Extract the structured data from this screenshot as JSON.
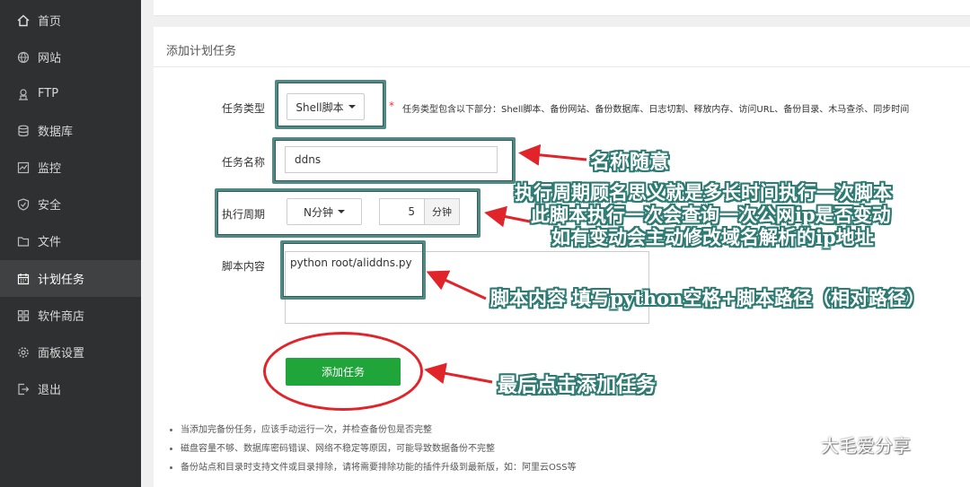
{
  "sidebar": {
    "items": [
      {
        "label": "首页",
        "icon": "home-icon"
      },
      {
        "label": "网站",
        "icon": "globe-icon"
      },
      {
        "label": "FTP",
        "icon": "ftp-icon"
      },
      {
        "label": "数据库",
        "icon": "database-icon"
      },
      {
        "label": "监控",
        "icon": "monitor-icon"
      },
      {
        "label": "安全",
        "icon": "shield-icon"
      },
      {
        "label": "文件",
        "icon": "folder-icon"
      },
      {
        "label": "计划任务",
        "icon": "calendar-icon",
        "active": true
      },
      {
        "label": "软件商店",
        "icon": "grid-icon"
      },
      {
        "label": "面板设置",
        "icon": "gear-icon"
      },
      {
        "label": "退出",
        "icon": "logout-icon"
      }
    ]
  },
  "panel": {
    "title": "添加计划任务",
    "task_type_label": "任务类型",
    "task_type_value": "Shell脚本",
    "task_type_star": "*",
    "task_type_hint": "任务类型包含以下部分：Shell脚本、备份网站、备份数据库、日志切割、释放内存、访问URL、备份目录、木马查杀、同步时间",
    "task_name_label": "任务名称",
    "task_name_value": "ddns",
    "cycle_label": "执行周期",
    "cycle_value": "N分钟",
    "cycle_minutes": "5",
    "cycle_unit": "分钟",
    "script_label": "脚本内容",
    "script_value": "python root/aliddns.py",
    "submit_label": "添加任务"
  },
  "tips": [
    "当添加完备份任务，应该手动运行一次，并检查备份包是否完整",
    "磁盘容量不够、数据库密码错误、网络不稳定等原因，可能导致数据备份不完整",
    "备份站点和目录时支持文件或目录排除，请将需要排除功能的插件升级到最新版，如：阿里云OSS等"
  ],
  "annotations": {
    "name_note": "名称随意",
    "cycle_note_1": "执行周期顾名思义就是多长时间执行一次脚本",
    "cycle_note_2": "此脚本执行一次会查询一次公网ip是否变动",
    "cycle_note_3": "如有变动会主动修改域名解析的ip地址",
    "script_note": "脚本内容 填写python空格+脚本路径（相对路径）",
    "submit_note": "最后点击添加任务"
  },
  "watermark": {
    "text": "大毛爱分享",
    "icon": "wechat-icon"
  },
  "colors": {
    "sidebar_bg": "#2f3031",
    "accent_green": "#20a53a",
    "annotation_teal": "#4f8a85",
    "annotation_red": "#e0242a"
  }
}
